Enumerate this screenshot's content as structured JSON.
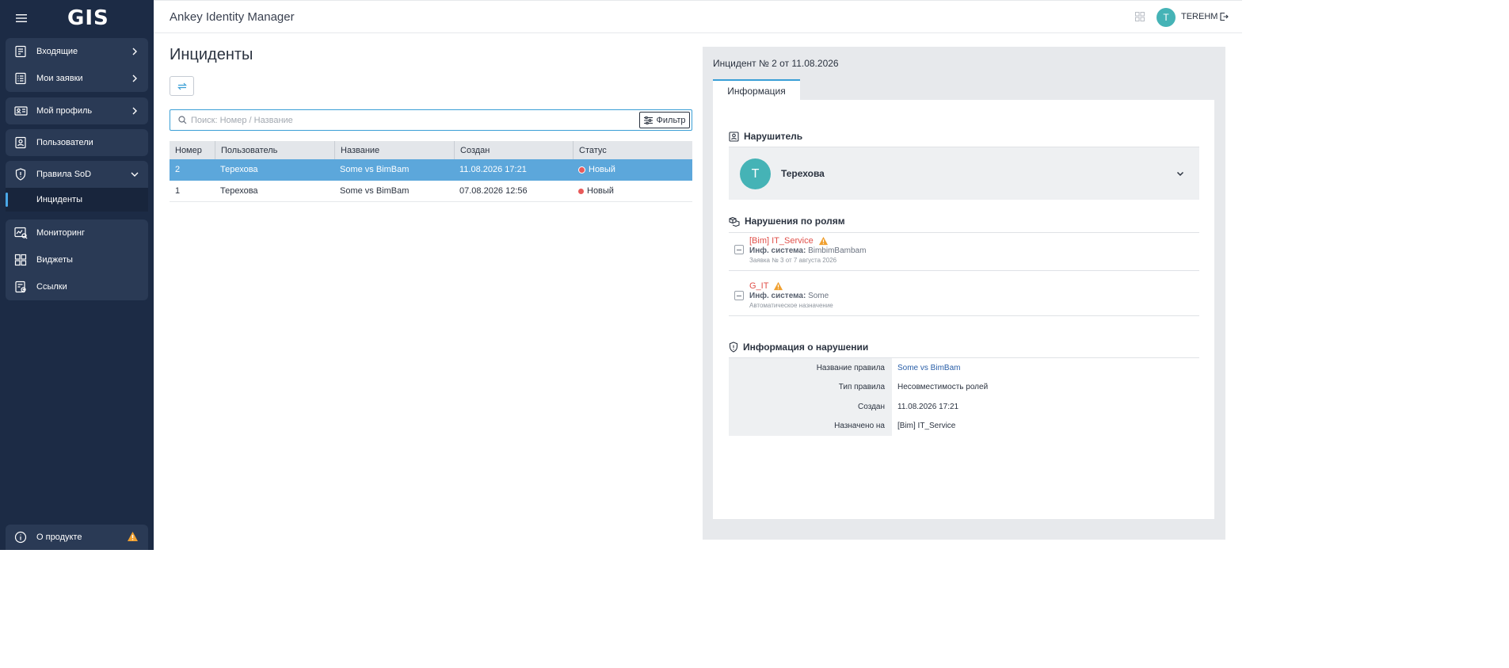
{
  "app": {
    "logo": "GIS",
    "title": "Ankey Identity Manager",
    "user": "TEREHM",
    "avatar_letter": "T"
  },
  "sidebar": {
    "items": [
      {
        "label": "Входящие",
        "icon": "inbox-icon"
      },
      {
        "label": "Мои заявки",
        "icon": "requests-icon"
      },
      {
        "label": "Мой профиль",
        "icon": "profile-card-icon"
      },
      {
        "label": "Пользователи",
        "icon": "users-icon"
      },
      {
        "label": "Правила SoD",
        "icon": "shield-icon"
      },
      {
        "label": "Инциденты"
      },
      {
        "label": "Мониторинг",
        "icon": "monitoring-icon"
      },
      {
        "label": "Виджеты",
        "icon": "widgets-icon"
      },
      {
        "label": "Ссылки",
        "icon": "links-icon"
      }
    ],
    "about": "О продукте"
  },
  "main": {
    "title": "Инциденты",
    "search_placeholder": "Поиск: Номер / Название",
    "filter_label": "Фильтр",
    "columns": [
      "Номер",
      "Пользователь",
      "Название",
      "Создан",
      "Статус"
    ],
    "rows": [
      {
        "num": "2",
        "user": "Терехова",
        "name": "Some vs BimBam",
        "created": "11.08.2026 17:21",
        "status": "Новый",
        "selected": true
      },
      {
        "num": "1",
        "user": "Терехова",
        "name": "Some vs BimBam",
        "created": "07.08.2026 12:56",
        "status": "Новый",
        "selected": false
      }
    ]
  },
  "detail": {
    "title": "Инцидент № 2 от 11.08.2026",
    "tab": "Информация",
    "violator_header": "Нарушитель",
    "violator_name": "Терехова",
    "violator_letter": "T",
    "roles_header": "Нарушения по ролям",
    "roles": [
      {
        "name": "[Bim] IT_Service",
        "sys_label": "Инф. система:",
        "sys_value": "BimbimBambam",
        "note": "Заявка № 3 от 7 августа 2026"
      },
      {
        "name": "G_IT",
        "sys_label": "Инф. система:",
        "sys_value": "Some",
        "note": "Автоматическое назначение"
      }
    ],
    "info_header": "Информация о нарушении",
    "info": [
      {
        "key": "Название правила",
        "value": "Some vs BimBam"
      },
      {
        "key": "Тип правила",
        "value": "Несовместимость ролей"
      },
      {
        "key": "Создан",
        "value": "11.08.2026 17:21"
      },
      {
        "key": "Назначено на",
        "value": "[Bim] IT_Service"
      }
    ]
  },
  "colors": {
    "sidebar": "#1c2b45",
    "accent": "#3a9fd6",
    "selected_row": "#5ca7db",
    "danger": "#e0504a",
    "warning": "#f0a030",
    "avatar": "#45b3b6"
  }
}
